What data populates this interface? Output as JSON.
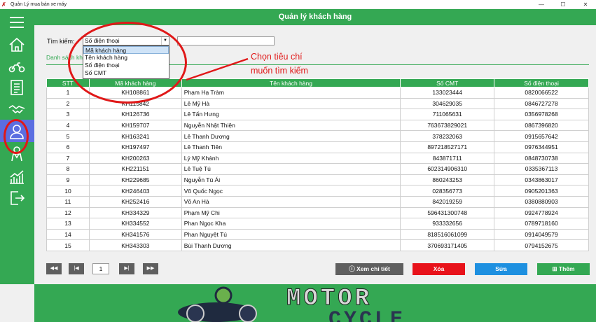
{
  "window": {
    "title": "Quản Lý mua bán xe máy",
    "minimize": "—",
    "maximize": "☐",
    "close": "✕"
  },
  "header": {
    "title": "Quản lý khách hàng"
  },
  "search": {
    "label": "Tìm kiếm:",
    "selected": "Số điện thoại",
    "options": [
      "Mã khách hàng",
      "Tên khách hàng",
      "Số điện thoại",
      "Số CMT"
    ],
    "value": ""
  },
  "list_label": "Danh sách kh",
  "annotation": {
    "line1": "Chọn tiêu chí",
    "line2": "muốn tìm kiếm",
    "color": "#e01818"
  },
  "table": {
    "headers": [
      "STT",
      "Mã khách hàng",
      "Tên khách hàng",
      "Số CMT",
      "Số điện thoại"
    ],
    "rows": [
      [
        "1",
        "KH108861",
        "Phạm Hạ Tràm",
        "133023444",
        "0820066522"
      ],
      [
        "2",
        "KH115842",
        "Lê Mỹ Hà",
        "304629035",
        "0846727278"
      ],
      [
        "3",
        "KH126736",
        "Lê Tấn Hưng",
        "711065631",
        "0356978268"
      ],
      [
        "4",
        "KH159707",
        "Nguyễn Nhật Thiện",
        "763673829021",
        "0867396820"
      ],
      [
        "5",
        "KH163241",
        "Lê Thanh Dương",
        "378232063",
        "0915657642"
      ],
      [
        "6",
        "KH197497",
        "Lê Thanh Tiên",
        "897218527171",
        "0976344951"
      ],
      [
        "7",
        "KH200263",
        "Lý Mỹ Khánh",
        "843871711",
        "0848730738"
      ],
      [
        "8",
        "KH221151",
        "Lê Tuệ Tú",
        "602314906310",
        "0335367113"
      ],
      [
        "9",
        "KH229685",
        "Nguyễn Tú Ái",
        "860243253",
        "0343863017"
      ],
      [
        "10",
        "KH246403",
        "Võ Quốc Ngọc",
        "028356773",
        "0905201363"
      ],
      [
        "11",
        "KH252416",
        "Võ An Hà",
        "842019259",
        "0380880903"
      ],
      [
        "12",
        "KH334329",
        "Phạm Mỹ Chi",
        "596431300748",
        "0924778924"
      ],
      [
        "13",
        "KH334552",
        "Phan Ngọc Kha",
        "933332656",
        "0789718160"
      ],
      [
        "14",
        "KH341576",
        "Phan Nguyệt Tú",
        "818516061099",
        "0914049579"
      ],
      [
        "15",
        "KH343303",
        "Bùi Thanh Dương",
        "370693171405",
        "0794152675"
      ]
    ]
  },
  "pager": {
    "first": "◀◀",
    "prev": "|◀",
    "page": "1",
    "next": "▶|",
    "last": "▶▶"
  },
  "actions": {
    "detail": "Xem chi tiết",
    "delete": "Xóa",
    "edit": "Sửa",
    "add": "Thêm"
  },
  "colors": {
    "accent": "#34a853",
    "active_nav": "#5b6ee1",
    "delete": "#e8121a",
    "edit": "#1e90e0",
    "detail": "#5f5f5f"
  },
  "sidebar_icons": [
    "menu-icon",
    "home-icon",
    "motorbike-icon",
    "invoice-icon",
    "handshake-icon",
    "customers-icon",
    "employee-icon",
    "statistics-icon",
    "logout-icon"
  ],
  "banner": {
    "line1": "MOTOR",
    "line2": "CYCLE"
  }
}
